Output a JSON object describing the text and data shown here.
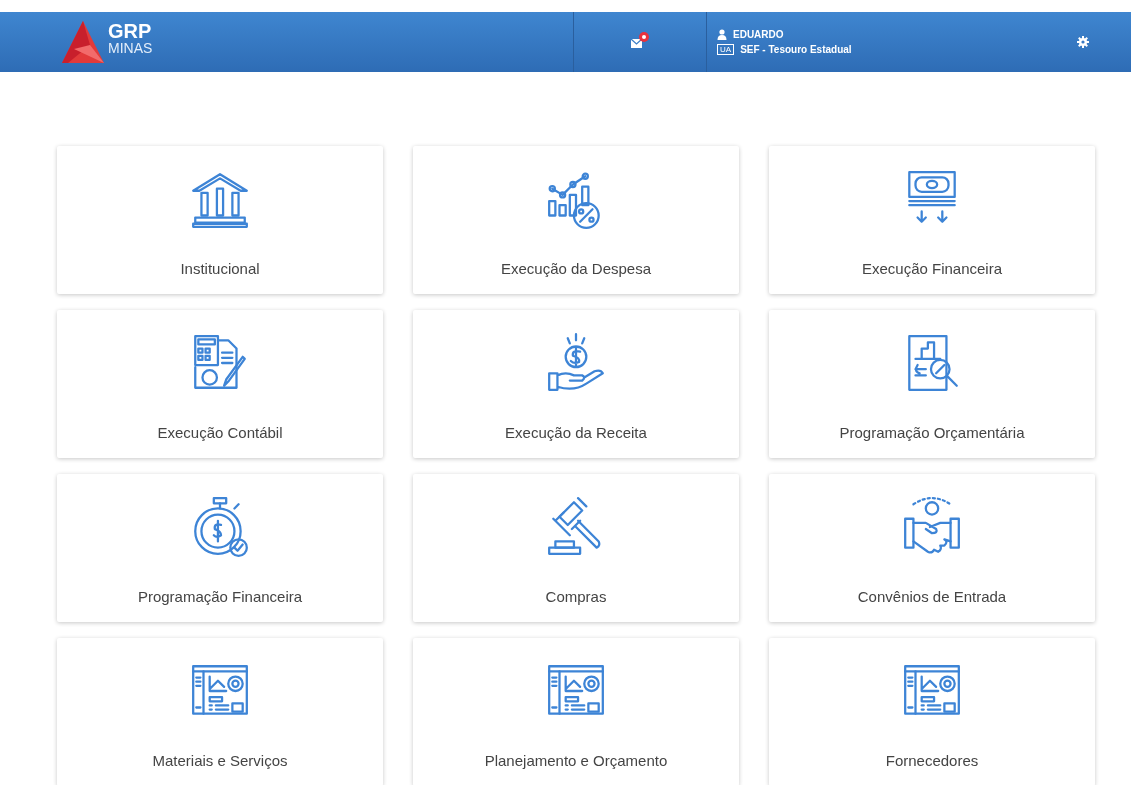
{
  "header": {
    "logo": {
      "title": "GRP",
      "subtitle": "MINAS"
    },
    "notifications": {
      "unread": true
    },
    "user": {
      "name": "EDUARDO",
      "unit_badge": "UA",
      "unit": "SEF - Tesouro Estadual"
    }
  },
  "tiles": [
    {
      "label": "Institucional"
    },
    {
      "label": "Execução da Despesa"
    },
    {
      "label": "Execução Financeira"
    },
    {
      "label": "Execução Contábil"
    },
    {
      "label": "Execução da Receita"
    },
    {
      "label": "Programação Orçamentária"
    },
    {
      "label": "Programação Financeira"
    },
    {
      "label": "Compras"
    },
    {
      "label": "Convênios de Entrada"
    },
    {
      "label": "Materiais e Serviços"
    },
    {
      "label": "Planejamento e Orçamento"
    },
    {
      "label": "Fornecedores"
    }
  ]
}
